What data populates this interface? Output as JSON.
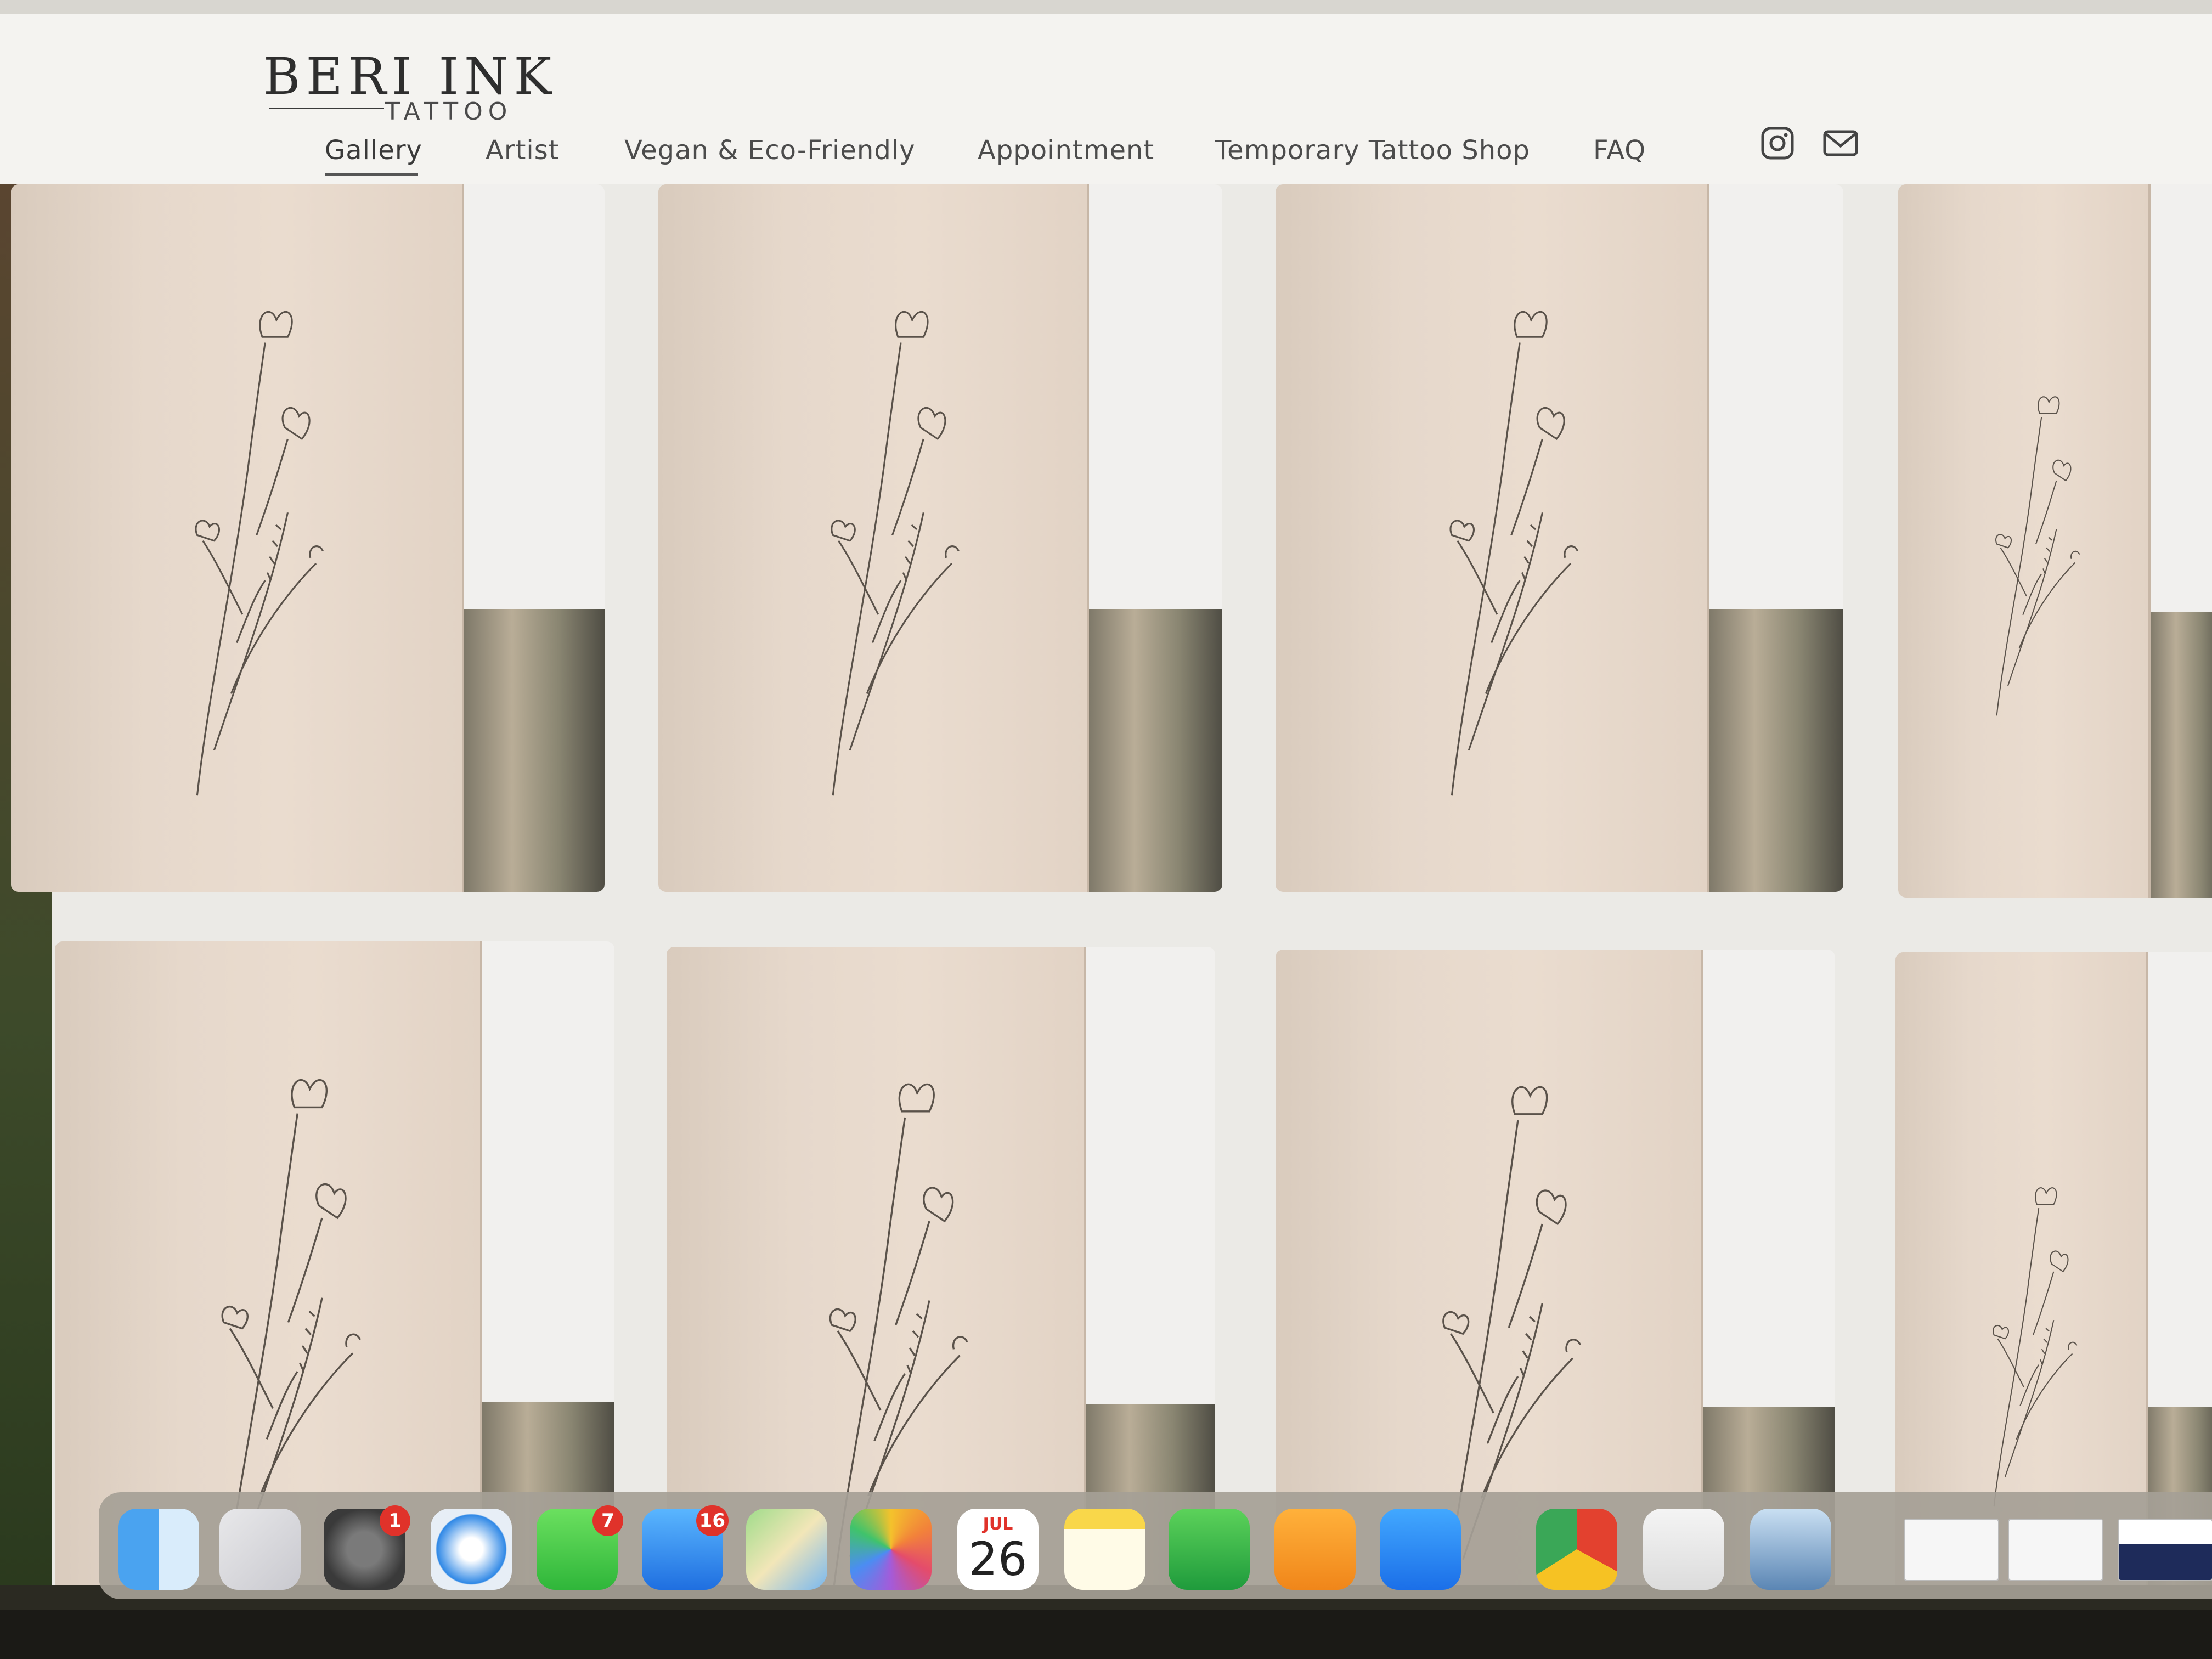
{
  "site": {
    "logo_main": "BERI INK",
    "logo_sub": "TATTOO"
  },
  "nav": {
    "items": [
      {
        "label": "Gallery",
        "active": true
      },
      {
        "label": "Artist",
        "active": false
      },
      {
        "label": "Vegan & Eco-Friendly",
        "active": false
      },
      {
        "label": "Appointment",
        "active": false
      },
      {
        "label": "Temporary Tattoo Shop",
        "active": false
      },
      {
        "label": "FAQ",
        "active": false
      }
    ],
    "icons": [
      "instagram-icon",
      "mail-icon"
    ]
  },
  "gallery": {
    "rows": 2,
    "columns_visible": 4,
    "subject": "fine line wildflower tattoo"
  },
  "dock": {
    "apps": [
      {
        "name": "Finder",
        "icon": "finder-icon"
      },
      {
        "name": "Launchpad",
        "icon": "launchpad-icon"
      },
      {
        "name": "System Settings",
        "icon": "settings-icon",
        "badge": "1"
      },
      {
        "name": "Safari",
        "icon": "safari-icon"
      },
      {
        "name": "Messages",
        "icon": "messages-icon",
        "badge": "7"
      },
      {
        "name": "Mail",
        "icon": "mail-app-icon",
        "badge": "16"
      },
      {
        "name": "Maps",
        "icon": "maps-icon"
      },
      {
        "name": "Photos",
        "icon": "photos-icon"
      },
      {
        "name": "Calendar",
        "icon": "calendar-icon",
        "month": "JUL",
        "day": "26"
      },
      {
        "name": "Notes",
        "icon": "notes-icon"
      },
      {
        "name": "Numbers",
        "icon": "numbers-icon"
      },
      {
        "name": "Pages",
        "icon": "pages-icon"
      },
      {
        "name": "App Store",
        "icon": "app-store-icon"
      },
      {
        "name": "Chrome",
        "icon": "chrome-icon"
      },
      {
        "name": "Passwords",
        "icon": "passwords-icon"
      },
      {
        "name": "Preview",
        "icon": "preview-icon"
      }
    ]
  },
  "colors": {
    "badge": "#e0322a",
    "header_bg": "#f4f3f0",
    "page_bg": "#ebeae6"
  }
}
